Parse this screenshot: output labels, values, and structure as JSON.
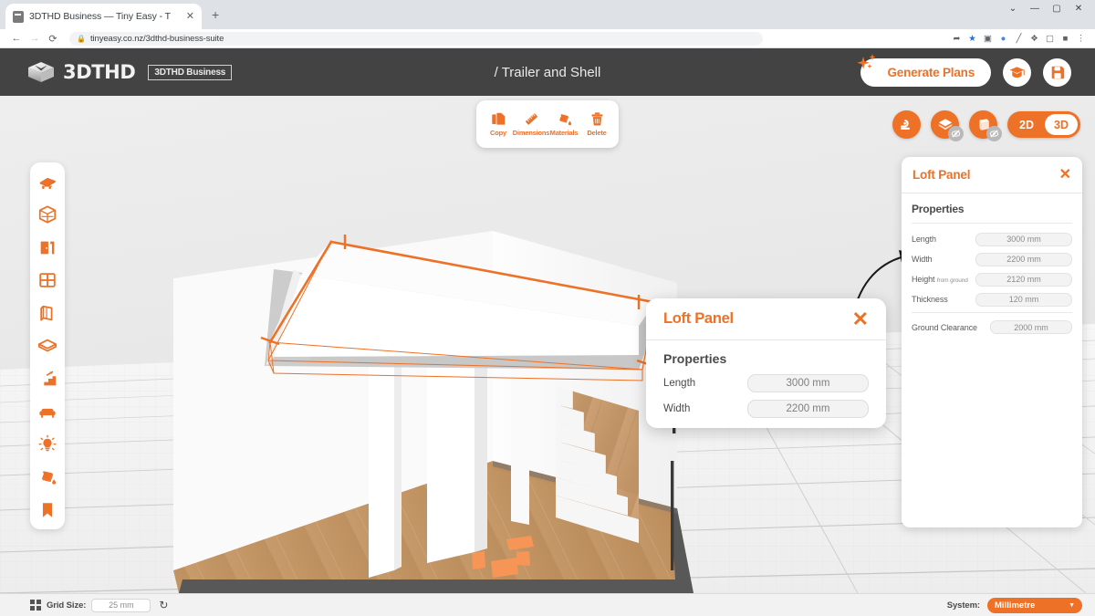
{
  "browser": {
    "tab_title": "3DTHD Business — Tiny Easy - T",
    "tab_close": "✕",
    "new_tab": "+",
    "url": "tinyeasy.co.nz/3dthd-business-suite",
    "back": "←",
    "forward": "→",
    "reload": "⟳",
    "lock": "🔒",
    "window_minimize": "—",
    "window_maximize": "▢",
    "window_close": "✕",
    "window_chevron": "⌄",
    "toolbar_icons": [
      "share-icon",
      "bookmark-star-icon",
      "camera-icon",
      "lens-icon",
      "eyedropper-icon",
      "extensions-icon",
      "sidepanel-icon",
      "profile-icon",
      "more-menu-icon"
    ]
  },
  "header": {
    "logo_text": "3DTHD",
    "badge": "3DTHD Business",
    "title": "/ Trailer and Shell",
    "generate_plans": "Generate Plans",
    "learn_button_icon": "graduation-cap-icon",
    "save_button_icon": "save-disk-icon"
  },
  "tool_popup": {
    "items": [
      {
        "label": "Copy",
        "icon": "copy-icon"
      },
      {
        "label": "Dimensions",
        "icon": "ruler-icon"
      },
      {
        "label": "Materials",
        "icon": "paint-bucket-icon"
      },
      {
        "label": "Delete",
        "icon": "trash-icon"
      }
    ]
  },
  "sidebar": {
    "items": [
      {
        "name": "trailer",
        "icon": "trailer-icon"
      },
      {
        "name": "shell",
        "icon": "shell-box-icon"
      },
      {
        "name": "door",
        "icon": "door-icon"
      },
      {
        "name": "window",
        "icon": "window-icon"
      },
      {
        "name": "wall",
        "icon": "wall-icon"
      },
      {
        "name": "loft",
        "icon": "loft-layers-icon"
      },
      {
        "name": "stairs",
        "icon": "stairs-icon"
      },
      {
        "name": "furniture",
        "icon": "furniture-sofa-icon"
      },
      {
        "name": "lighting",
        "icon": "lightbulb-icon"
      },
      {
        "name": "materials",
        "icon": "paint-bucket-icon"
      },
      {
        "name": "bookmarks",
        "icon": "bookmark-icon"
      }
    ]
  },
  "view_controls": {
    "measure_icon": "tape-measure-icon",
    "roof_icon": "roof-visibility-icon",
    "walls_icon": "walls-visibility-icon",
    "hidden_badge_icon": "eye-slash-icon",
    "dim_2d": "2D",
    "dim_3d": "3D",
    "dim_active": "3D"
  },
  "right_panel": {
    "title": "Loft Panel",
    "close": "✕",
    "section": "Properties",
    "properties": [
      {
        "label": "Length",
        "sub": "",
        "value": "3000 mm"
      },
      {
        "label": "Width",
        "sub": "",
        "value": "2200 mm"
      },
      {
        "label": "Height",
        "sub": "from ground",
        "value": "2120 mm"
      },
      {
        "label": "Thickness",
        "sub": "",
        "value": "120 mm"
      }
    ],
    "footer_property": {
      "label": "Ground Clearance",
      "value": "2000 mm"
    }
  },
  "zoom_dialog": {
    "title": "Loft Panel",
    "close": "✕",
    "section": "Properties",
    "properties": [
      {
        "label": "Length",
        "value": "3000 mm"
      },
      {
        "label": "Width",
        "value": "2200 mm"
      }
    ]
  },
  "bottom_bar": {
    "grid_icon": "grid-icon",
    "grid_label": "Grid Size:",
    "grid_value": "25 mm",
    "reset_icon": "reset-arrow-icon",
    "system_label": "System:",
    "system_value": "Millimetre",
    "system_caret": "▼"
  },
  "colors": {
    "accent": "#ED7126",
    "header_bg": "#434343",
    "panel_bg": "#ffffff",
    "viewport_bg": "#f3f3f3",
    "floor_wood": "#c69c6d"
  }
}
